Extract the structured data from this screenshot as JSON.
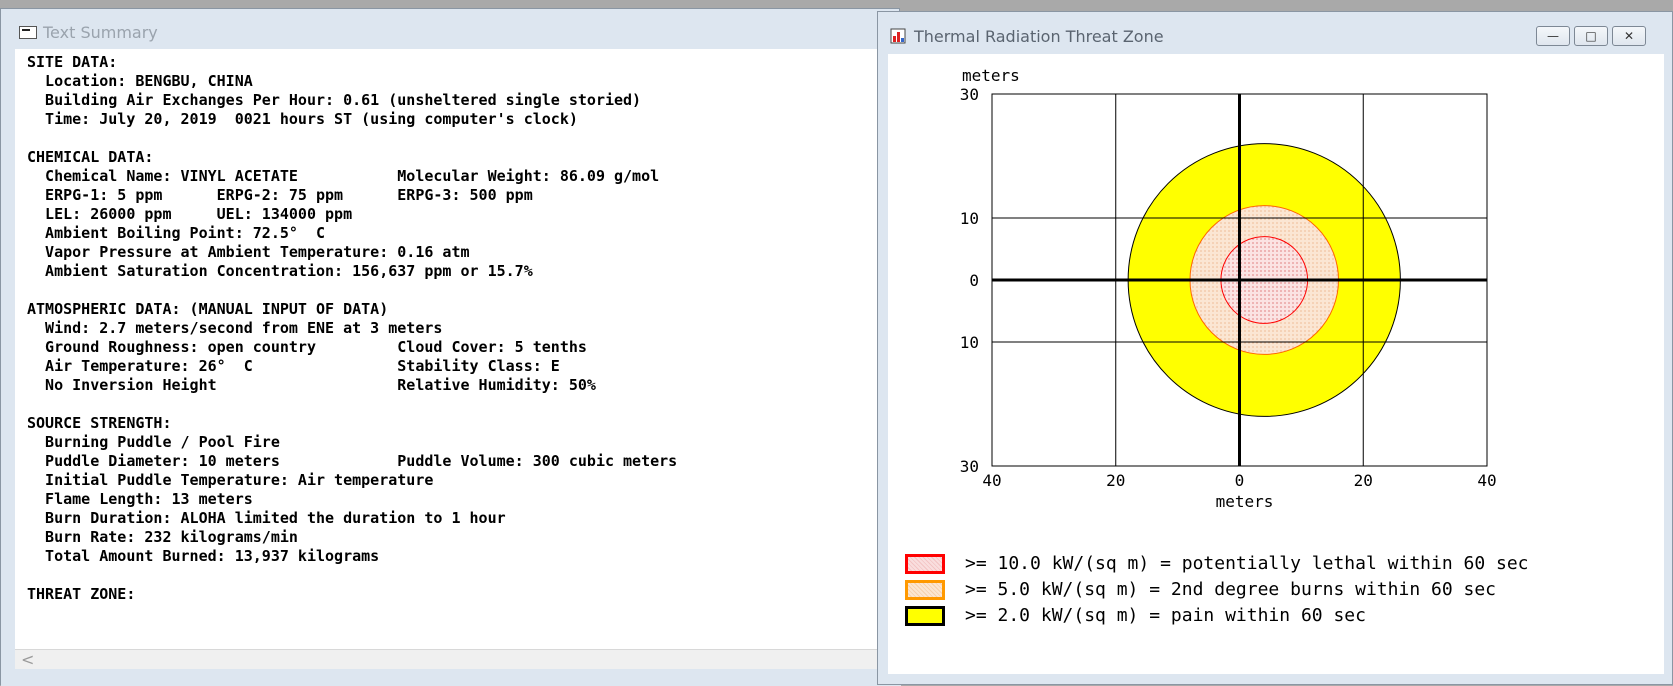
{
  "text_summary": {
    "title": "Text Summary",
    "lines": [
      "SITE DATA:",
      "  Location: BENGBU, CHINA",
      "  Building Air Exchanges Per Hour: 0.61 (unsheltered single storied)",
      "  Time: July 20, 2019  0021 hours ST (using computer's clock)",
      "",
      "CHEMICAL DATA:",
      "  Chemical Name: VINYL ACETATE           Molecular Weight: 86.09 g/mol",
      "  ERPG-1: 5 ppm      ERPG-2: 75 ppm      ERPG-3: 500 ppm",
      "  LEL: 26000 ppm     UEL: 134000 ppm",
      "  Ambient Boiling Point: 72.5°  C",
      "  Vapor Pressure at Ambient Temperature: 0.16 atm",
      "  Ambient Saturation Concentration: 156,637 ppm or 15.7%",
      "",
      "ATMOSPHERIC DATA: (MANUAL INPUT OF DATA)",
      "  Wind: 2.7 meters/second from ENE at 3 meters",
      "  Ground Roughness: open country         Cloud Cover: 5 tenths",
      "  Air Temperature: 26°  C                Stability Class: E",
      "  No Inversion Height                    Relative Humidity: 50%",
      "",
      "SOURCE STRENGTH:",
      "  Burning Puddle / Pool Fire",
      "  Puddle Diameter: 10 meters             Puddle Volume: 300 cubic meters",
      "  Initial Puddle Temperature: Air temperature",
      "  Flame Length: 13 meters",
      "  Burn Duration: ALOHA limited the duration to 1 hour",
      "  Burn Rate: 232 kilograms/min",
      "  Total Amount Burned: 13,937 kilograms",
      "",
      "THREAT ZONE:"
    ],
    "scroll_left_glyph": "<"
  },
  "threat_zone_window": {
    "title": "Thermal Radiation Threat Zone",
    "buttons": {
      "minimize": "—",
      "maximize": "□",
      "close": "✕"
    },
    "legend": [
      {
        "label": ">= 10.0 kW/(sq m) = potentially lethal within 60 sec",
        "color": "#ff0000",
        "fill": "#f9dede"
      },
      {
        "label": ">= 5.0 kW/(sq m) = 2nd degree burns within 60 sec",
        "color": "#ff9900",
        "fill": "#fbe6d3"
      },
      {
        "label": ">= 2.0 kW/(sq m) = pain within 60 sec",
        "color": "#000000",
        "fill": "#ffff00"
      }
    ]
  },
  "chart_data": {
    "type": "area",
    "xlabel": "meters",
    "ylabel": "meters",
    "xlim": [
      -40,
      40
    ],
    "ylim": [
      -30,
      30
    ],
    "x_tick_labels": [
      "40",
      "20",
      "0",
      "20",
      "40"
    ],
    "x_tick_values": [
      -40,
      -20,
      0,
      20,
      40
    ],
    "y_tick_labels": [
      "30",
      "10",
      "0",
      "10",
      "30"
    ],
    "y_tick_values": [
      30,
      10,
      0,
      -10,
      -30
    ],
    "grid": true,
    "zones": [
      {
        "name": ">= 2.0 kW/(sq m)",
        "shape": "circle",
        "center": [
          4,
          0
        ],
        "radius": 22,
        "fill": "#ffff00",
        "stroke": "#000000"
      },
      {
        "name": ">= 5.0 kW/(sq m)",
        "shape": "circle",
        "center": [
          4,
          0
        ],
        "radius": 12,
        "fill": "#fbe6d3",
        "stroke": "#ff6600"
      },
      {
        "name": ">= 10.0 kW/(sq m)",
        "shape": "circle",
        "center": [
          4,
          0
        ],
        "radius": 7,
        "fill": "#f9dede",
        "stroke": "#ff0000"
      }
    ]
  }
}
